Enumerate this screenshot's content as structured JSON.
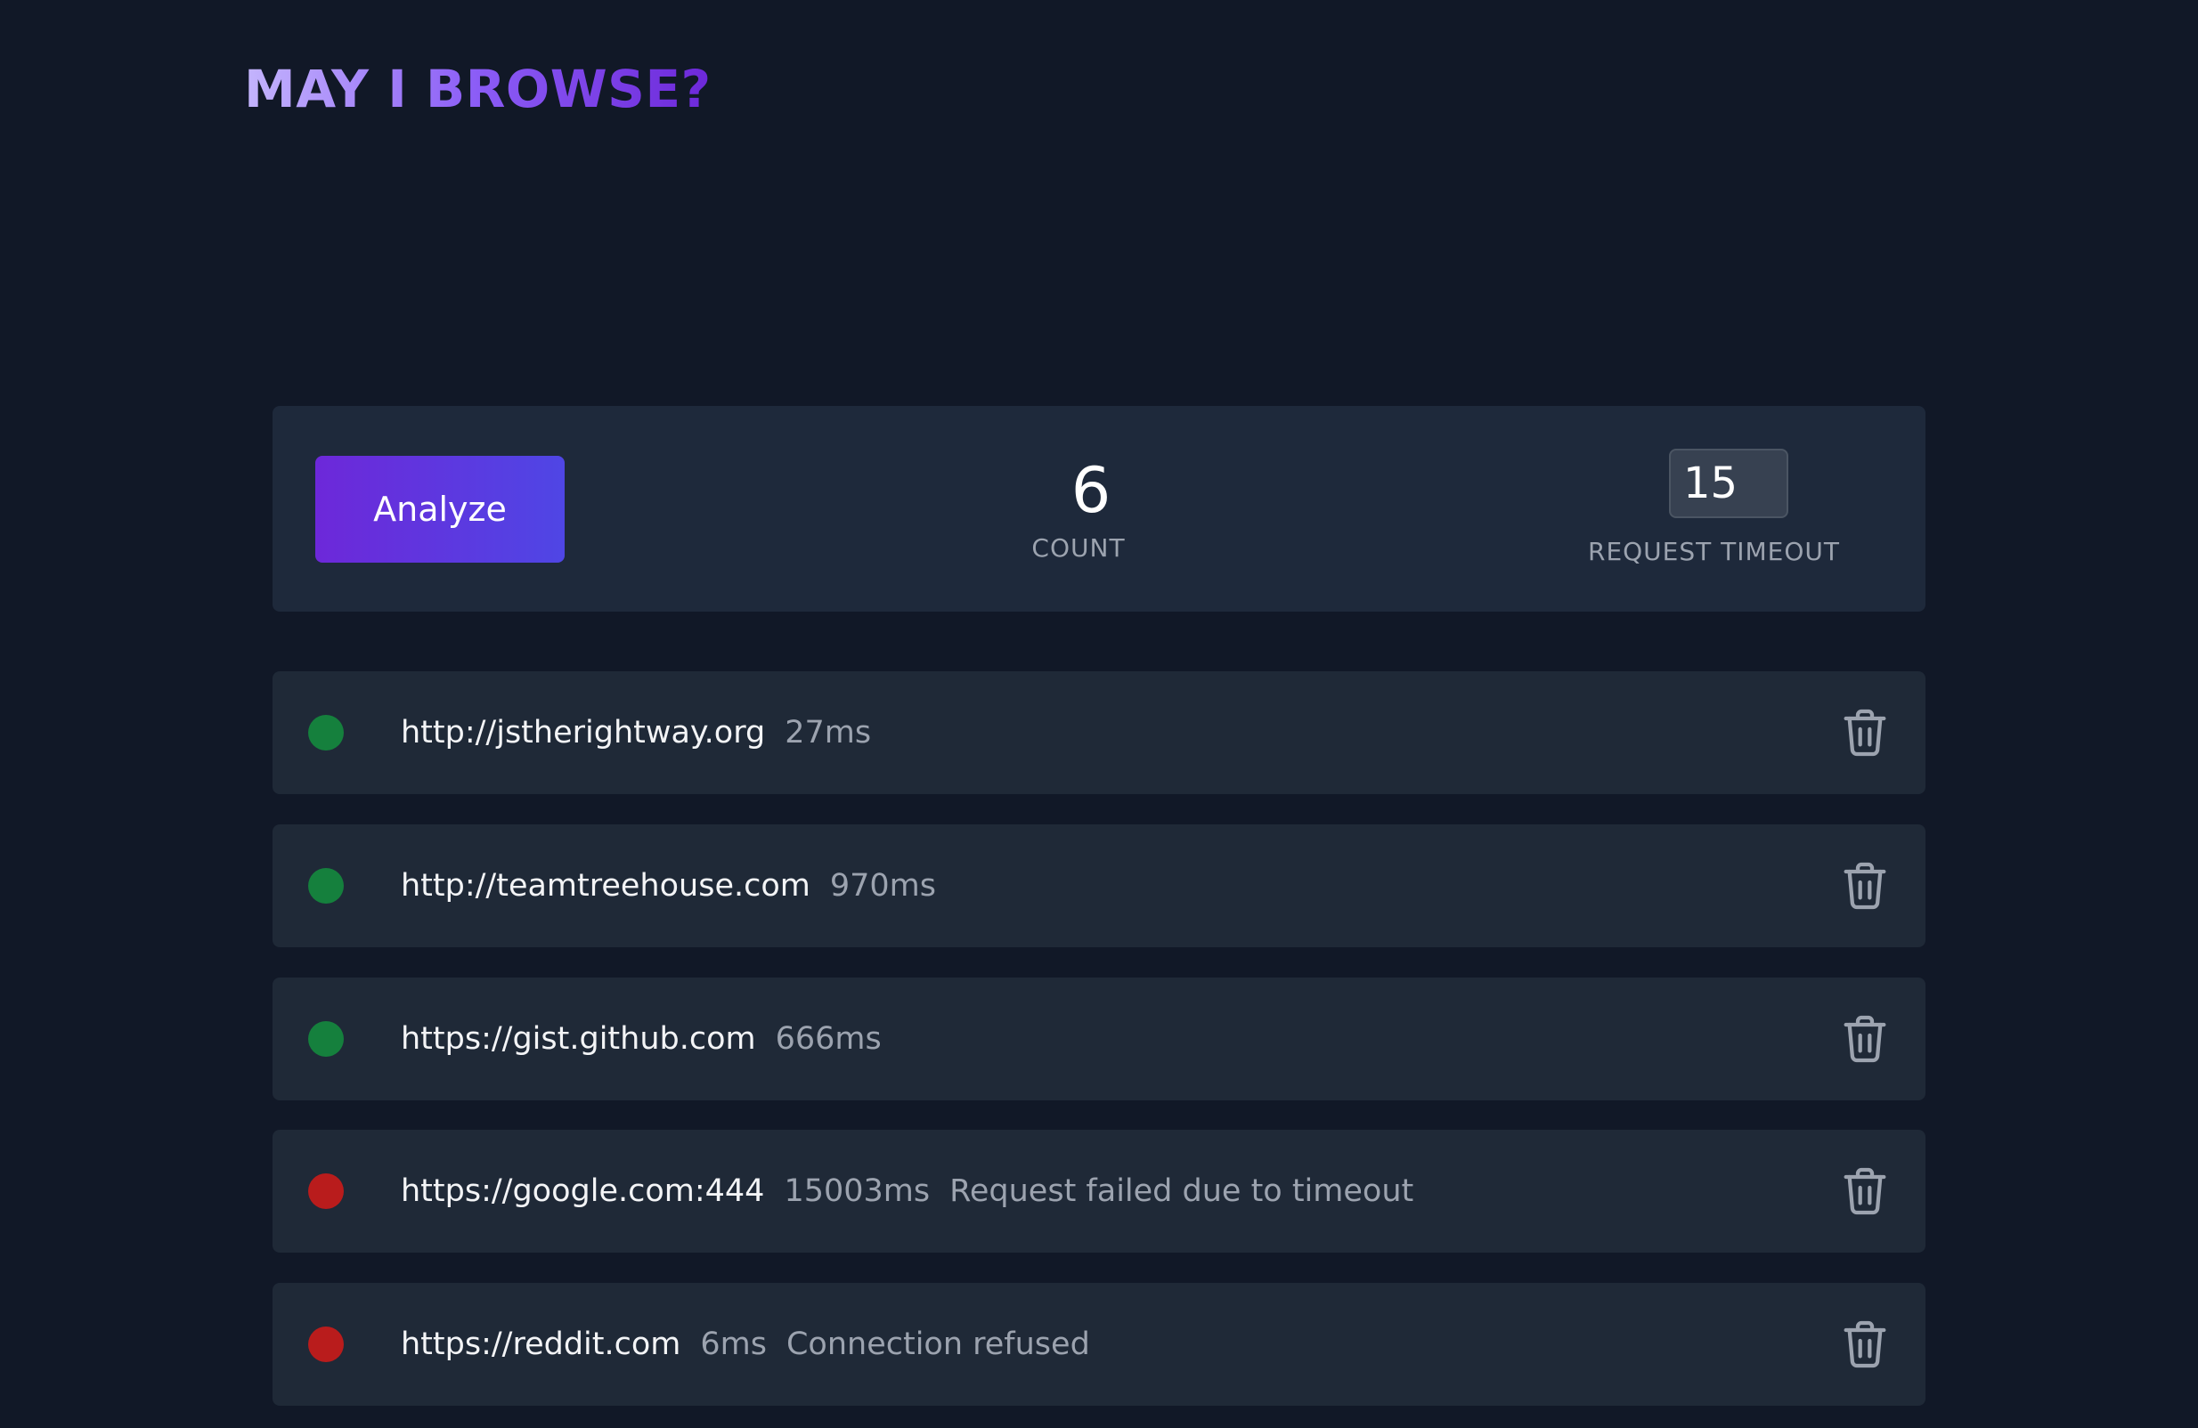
{
  "app": {
    "title": "MAY I BROWSE?"
  },
  "controls": {
    "analyze_label": "Analyze",
    "count_value": "6",
    "count_label": "COUNT",
    "timeout_value": "15",
    "timeout_label": "REQUEST TIMEOUT"
  },
  "colors": {
    "background": "#111827",
    "panel": "#1e293b",
    "row": "#1f2937",
    "status_ok": "#15803d",
    "status_fail": "#b91c1c",
    "accent_start": "#6d28d9",
    "accent_end": "#4f46e5"
  },
  "results": [
    {
      "status": "ok",
      "url": "http://jstherightway.org",
      "time": "27ms",
      "error": "",
      "icon": "trash-icon"
    },
    {
      "status": "ok",
      "url": "http://teamtreehouse.com",
      "time": "970ms",
      "error": "",
      "icon": "trash-icon"
    },
    {
      "status": "ok",
      "url": "https://gist.github.com",
      "time": "666ms",
      "error": "",
      "icon": "trash-icon"
    },
    {
      "status": "fail",
      "url": "https://google.com:444",
      "time": "15003ms",
      "error": "Request failed due to timeout",
      "icon": "trash-icon"
    },
    {
      "status": "fail",
      "url": "https://reddit.com",
      "time": "6ms",
      "error": "Connection refused",
      "icon": "trash-icon"
    }
  ]
}
